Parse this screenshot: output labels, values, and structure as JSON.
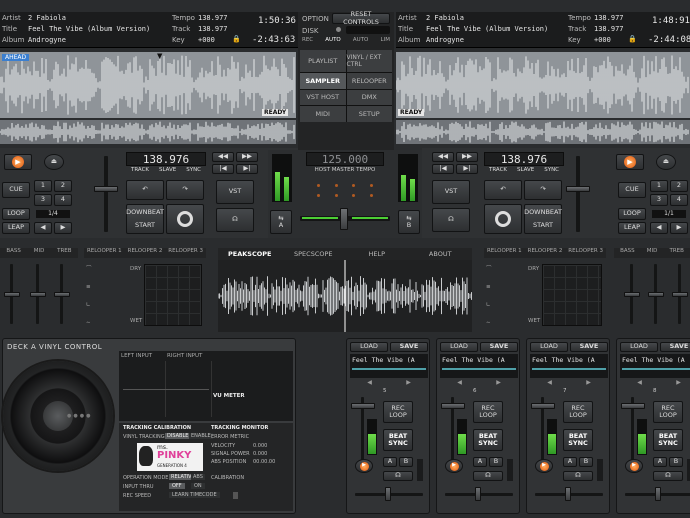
{
  "deck_left": {
    "artist_label": "Artist",
    "artist": "2 Fabiola",
    "title_label": "Title",
    "title": "Feel The Vibe (Album Version)",
    "album_label": "Album",
    "album": "Androgyne",
    "tempo_label": "Tempo",
    "tempo": "138.977",
    "track_label": "Track",
    "track": "138.977",
    "key_label": "Key",
    "key": "+000",
    "time_elapsed": "1:50:36",
    "time_remaining": "-2:43:63",
    "ahead": "AHEAD",
    "ready": "READY",
    "bpm": "138.976",
    "track_btn": "TRACK",
    "slave_btn": "SLAVE",
    "sync_btn": "SYNC",
    "cue": "CUE",
    "loop": "LOOP",
    "leap": "LEAP",
    "pads": [
      "1",
      "2",
      "3",
      "4"
    ],
    "loop_len": "1/4",
    "downbeat": "DOWNBEAT",
    "start": "START",
    "vst": "VST"
  },
  "deck_right": {
    "artist_label": "Artist",
    "artist": "2 Fabiola",
    "title_label": "Title",
    "title": "Feel The Vibe (Album Version)",
    "album_label": "Album",
    "album": "Androgyne",
    "tempo_label": "Tempo",
    "tempo": "138.977",
    "track_label": "Track",
    "track": "138.977",
    "key_label": "Key",
    "key": "+000",
    "time_elapsed": "1:48:91",
    "time_remaining": "-2:44:08",
    "ready": "READY",
    "bpm": "138.976",
    "track_btn": "TRACK",
    "slave_btn": "SLAVE",
    "sync_btn": "SYNC",
    "cue": "CUE",
    "loop": "LOOP",
    "leap": "LEAP",
    "pads": [
      "1",
      "2",
      "3",
      "4"
    ],
    "loop_len": "1/1",
    "downbeat": "DOWNBEAT",
    "start": "START",
    "vst": "VST"
  },
  "center": {
    "option": "OPTION",
    "disk": "DISK",
    "reset": "RESET CONTROLS",
    "modes": [
      "REC",
      "AUTO",
      "AUTO",
      "LIM"
    ],
    "menu": [
      "PLAYLIST",
      "VINYL / EXT CTRL",
      "SAMPLER",
      "RELOOPER",
      "VST HOST",
      "DMX",
      "MIDI",
      "SETUP"
    ],
    "host_tempo": "125.000",
    "host_tempo_label": "HOST MASTER TEMPO",
    "xfade_a": "A",
    "xfade_b": "B"
  },
  "eq": {
    "left": [
      "BASS",
      "MID",
      "TREB"
    ],
    "right": [
      "BASS",
      "MID",
      "TREB"
    ]
  },
  "relooper_tabs": [
    "RELOOPER 1",
    "RELOOPER 2",
    "RELOOPER 3"
  ],
  "relooper_dry": "DRY",
  "relooper_wet": "WET",
  "center_tabs": [
    "PEAKSCOPE",
    "SPECSCOPE",
    "HELP",
    "ABOUT"
  ],
  "vinyl": {
    "title": "DECK A VINYL CONTROL",
    "left_input": "LEFT INPUT",
    "right_input": "RIGHT INPUT",
    "vu": "VU METER",
    "tracking_cal": "TRACKING CALIBRATION",
    "tracking_mon": "TRACKING MONITOR",
    "vinyl_tracking": "VINYL TRACKING",
    "disable": "DISABLE",
    "enable": "ENABLE",
    "error_metric": "ERROR METRIC",
    "velocity": "VELOCITY",
    "velocity_val": "0.000",
    "signal_power": "SIGNAL POWER",
    "signal_val": "0.000",
    "abs_position": "ABS POSITION",
    "abs_val": "00.00.00",
    "op_mode": "OPERATION MODE",
    "relative": "RELATIVE",
    "abs": "ABS",
    "calibration": "CALIBRATION",
    "input_thru": "INPUT THRU",
    "off": "OFF",
    "on": "ON",
    "rec_speed": "REC SPEED",
    "learn": "LEARN TIMECODE",
    "logo_ms": "ms.",
    "logo_pinky": "PINKY",
    "logo_gen": "GENERATION 4"
  },
  "samplers": [
    {
      "load": "LOAD",
      "save": "SAVE",
      "title": "Feel The Vibe (A",
      "num": "5",
      "rec": "REC LOOP",
      "beat": "BEAT SYNC",
      "a": "A",
      "b": "B"
    },
    {
      "load": "LOAD",
      "save": "SAVE",
      "title": "Feel The Vibe (A",
      "num": "6",
      "rec": "REC LOOP",
      "beat": "BEAT SYNC",
      "a": "A",
      "b": "B"
    },
    {
      "load": "LOAD",
      "save": "SAVE",
      "title": "Feel The Vibe (A",
      "num": "7",
      "rec": "REC LOOP",
      "beat": "BEAT SYNC",
      "a": "A",
      "b": "B"
    },
    {
      "load": "LOAD",
      "save": "SAVE",
      "title": "Feel The Vibe (A",
      "num": "8",
      "rec": "REC LOOP",
      "beat": "BEAT SYNC",
      "a": "A",
      "b": "B"
    }
  ],
  "colors": {
    "accent": "#ff7a1a",
    "meter": "#5ccf3c",
    "logo": "#e0409a"
  }
}
